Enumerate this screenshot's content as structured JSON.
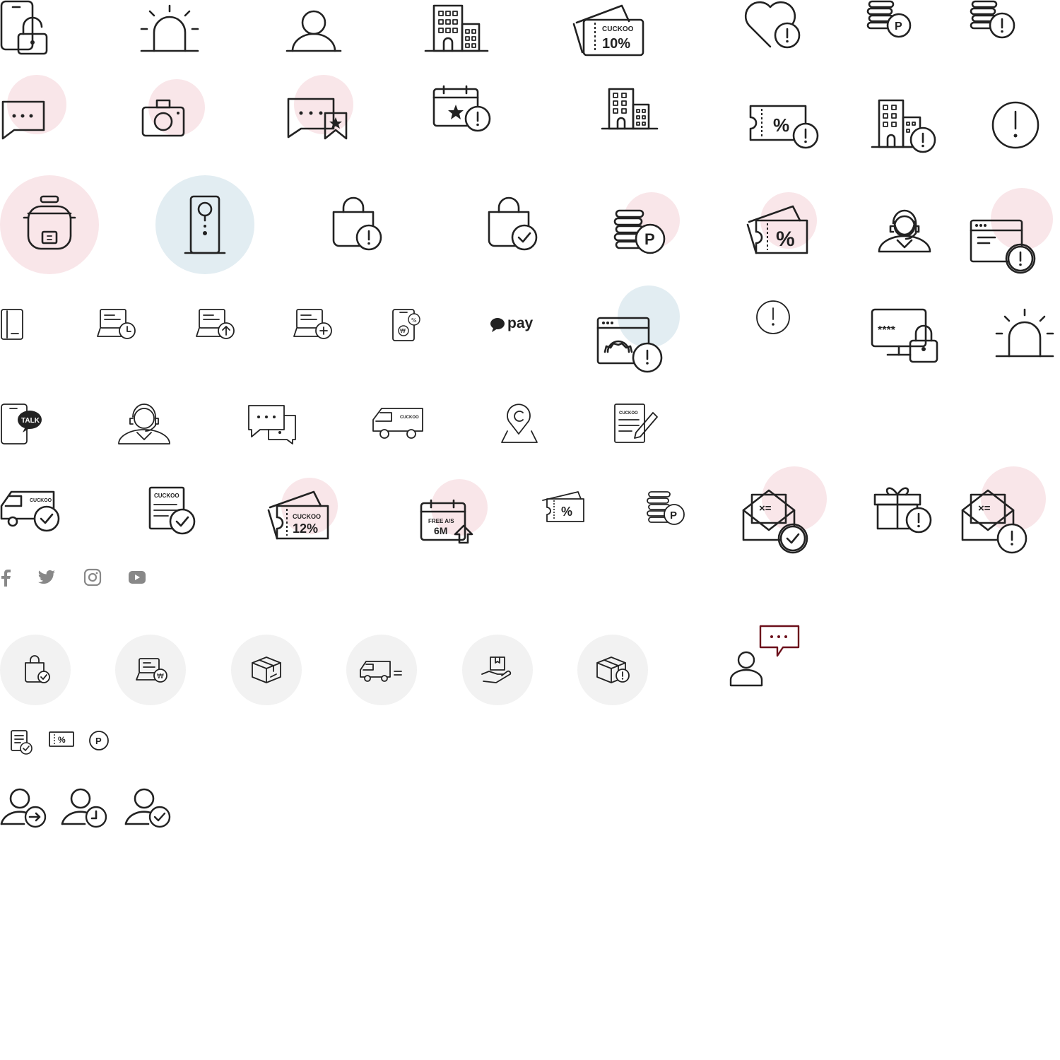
{
  "colors": {
    "stroke": "#222222",
    "pink_blob": "#f9e6e9",
    "blue_blob": "#e2edf2",
    "grey_circle": "#f2f2f2",
    "social_grey": "#888888",
    "accent_red": "#6b0f1a"
  },
  "labels": {
    "cuckoo": "CUCKOO",
    "coupon10": "10%",
    "coupon12": "12%",
    "percent": "%",
    "point": "P",
    "talk": "TALK",
    "pay": "pay",
    "password": "****",
    "free_as": "FREE A/S",
    "six_m": "6M",
    "won": "₩",
    "excl": "!"
  },
  "icons": [
    "phone-lock-icon",
    "siren-icon",
    "user-icon",
    "building-icon",
    "coupon-10-icon",
    "heart-alert-icon",
    "coins-point-icon",
    "coins-alert-icon",
    "chat-icon",
    "camera-icon",
    "chat-review-icon",
    "calendar-alert-icon",
    "building-icon",
    "coupon-alert-icon",
    "building-alert-icon",
    "alert-circle-icon",
    "rice-cooker-icon",
    "water-purifier-icon",
    "bag-alert-icon",
    "bag-check-icon",
    "coins-point-icon",
    "coupon-percent-icon",
    "counselor-icon",
    "browser-alert-icon",
    "phone-icon",
    "laptop-clock-icon",
    "laptop-upload-icon",
    "laptop-add-icon",
    "phone-exchange-icon",
    "pay-icon",
    "browser-settings-alert-icon",
    "alert-circle-icon",
    "monitor-password-icon",
    "siren-icon",
    "kakao-talk-icon",
    "counselor-icon",
    "chat-bubbles-icon",
    "delivery-van-icon",
    "location-pin-icon",
    "contract-sign-icon",
    "van-check-icon",
    "document-check-icon",
    "coupon-12-icon",
    "calendar-free-as-icon",
    "coupon-percent-icon",
    "coins-point-icon",
    "envelope-check-icon",
    "gift-alert-icon",
    "envelope-alert-icon",
    "facebook-icon",
    "twitter-icon",
    "instagram-icon",
    "youtube-icon",
    "bag-check-icon",
    "laptop-payment-icon",
    "box-icon",
    "van-fast-icon",
    "hand-box-icon",
    "box-alert-icon",
    "user-chat-icon",
    "document-check-icon",
    "coupon-icon",
    "point-icon",
    "user-arrow-icon",
    "user-clock-icon",
    "user-check-icon"
  ]
}
